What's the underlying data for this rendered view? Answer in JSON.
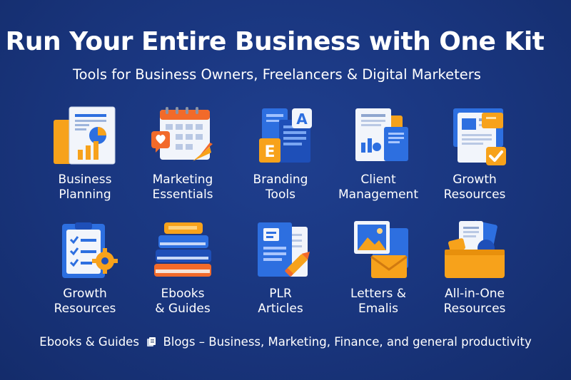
{
  "header": {
    "title": "Run Your Entire Business with One Kit",
    "subtitle": "Tools for Business Owners, Freelancers & Digital Marketers"
  },
  "tiles": [
    {
      "label": "Business\nPlanning",
      "icon": "business-plan-report-icon"
    },
    {
      "label": "Marketing\nEssentials",
      "icon": "marketing-calendar-icon"
    },
    {
      "label": "Branding\nTools",
      "icon": "branding-typography-icon"
    },
    {
      "label": "Client\nManagement",
      "icon": "client-documents-icon"
    },
    {
      "label": "Growth\nResources",
      "icon": "growth-documents-check-icon"
    },
    {
      "label": "Growth\nResources",
      "icon": "checklist-gear-icon"
    },
    {
      "label": "Ebooks\n& Guides",
      "icon": "book-stack-icon"
    },
    {
      "label": "PLR\nArticles",
      "icon": "articles-pencil-icon"
    },
    {
      "label": "Letters &\nEmalis",
      "icon": "image-envelope-icon"
    },
    {
      "label": "All-in-One\nResources",
      "icon": "resource-box-icon"
    }
  ],
  "footer": {
    "part1": "Ebooks & Guides",
    "part2": "Blogs – Business, Marketing, Finance, and general productivity"
  },
  "colors": {
    "background": "#19357d",
    "blue": "#2d6fe0",
    "orange": "#f7a21b",
    "paper": "#f2f5fb"
  }
}
